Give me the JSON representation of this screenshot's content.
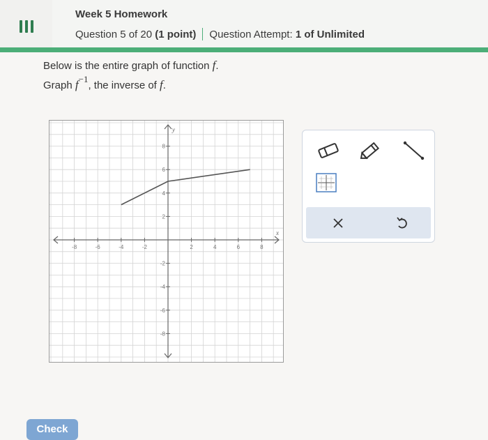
{
  "header": {
    "title": "Week 5 Homework",
    "question_progress": "Question 5 of 20",
    "points": "(1 point)",
    "attempt_label": "Question Attempt:",
    "attempt_value": "1 of Unlimited",
    "menu_icon": "hamburger-menu-icon"
  },
  "question": {
    "line1_prefix": "Below is the entire graph of function",
    "line1_var": "f",
    "line1_suffix": ".",
    "line2_prefix": "Graph",
    "line2_var": "f",
    "line2_sup": "−1",
    "line2_mid": ", the inverse of",
    "line2_var2": "f",
    "line2_suffix": "."
  },
  "graph": {
    "x_range": [
      -10,
      10
    ],
    "y_range": [
      -10,
      10
    ],
    "x_axis_label": "x",
    "y_axis_label": "y",
    "x_tick_labels": [
      "-8",
      "-6",
      "-4",
      "-2",
      "2",
      "4",
      "6",
      "8"
    ],
    "y_tick_labels": [
      "8",
      "6",
      "4",
      "2",
      "-2",
      "-4",
      "-6",
      "-8"
    ],
    "function_points": [
      [
        -4,
        3
      ],
      [
        0,
        5
      ],
      [
        7,
        6
      ]
    ],
    "line_color": "#555555",
    "grid_color": "#d4d4d4"
  },
  "tools": {
    "eraser_icon": "eraser-icon",
    "pencil_icon": "pencil-icon",
    "line_icon": "line-segment-icon",
    "grid_icon": "graph-grid-icon",
    "clear_icon": "close-icon",
    "undo_icon": "undo-icon"
  },
  "footer": {
    "check_label": "Check",
    "check_color": "#7ea6d3"
  },
  "colors": {
    "header_green": "#4cae78",
    "accent_blue": "#4a7fc1"
  }
}
